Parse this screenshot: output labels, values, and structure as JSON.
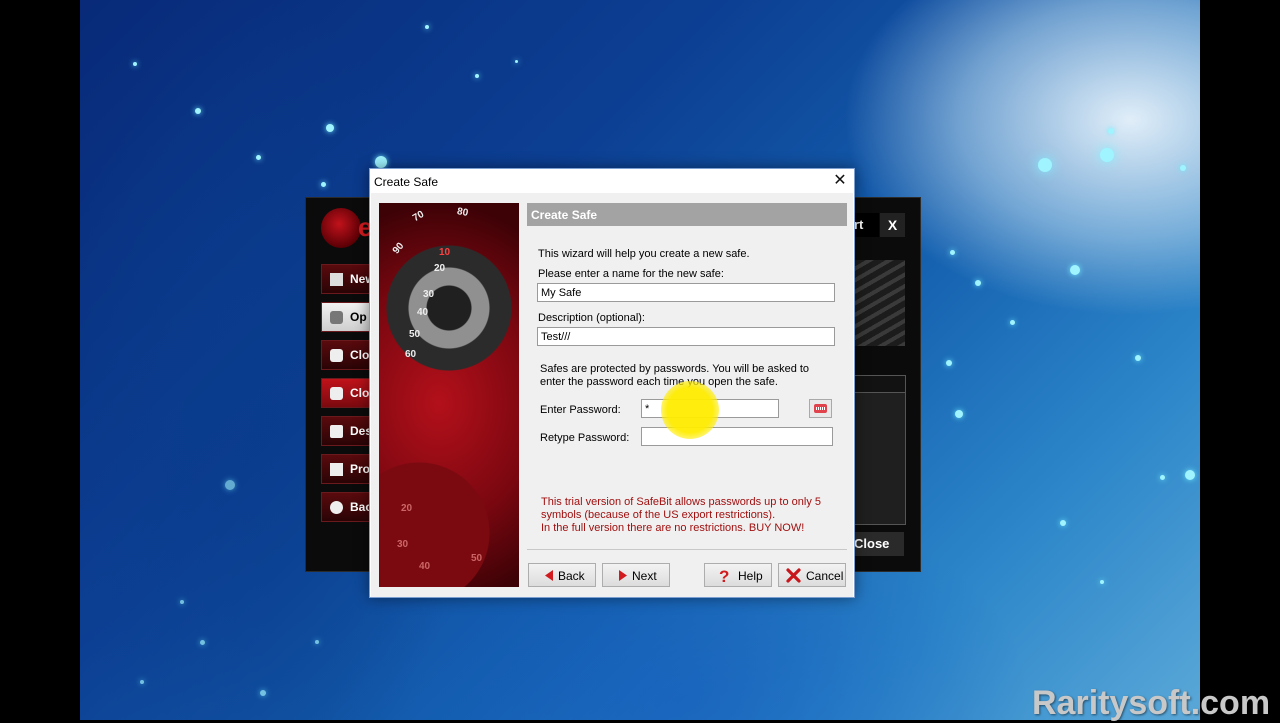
{
  "background_app": {
    "logo_letter": "e",
    "menu_items": [
      "New",
      "Op",
      "Clo",
      "Clo",
      "Des",
      "Pro",
      "Bac"
    ],
    "top_button_fragment": "rt",
    "close_x": "X",
    "close_label": "Close"
  },
  "dialog": {
    "title": "Create Safe",
    "close_glyph": "✕",
    "header_title": "Create Safe",
    "intro": "This wizard will help you create a new safe.",
    "name_label": "Please enter a name for the new safe:",
    "name_value": "My Safe",
    "description_label": "Description (optional):",
    "description_value": "Test///",
    "password_info_line1": "Safes are protected by passwords. You will be asked to",
    "password_info_line2": "enter the password each time you open the safe.",
    "enter_password_label": "Enter Password:",
    "enter_password_value": "*",
    "retype_password_label": "Retype Password:",
    "retype_password_value": "",
    "trial_line1": "This trial version of SafeBit allows passwords up to only 5",
    "trial_line2": "symbols (because of the US export restrictions).",
    "trial_line3": "In the full version there are no restrictions. BUY NOW!",
    "buttons": {
      "back": "Back",
      "next": "Next",
      "help": "Help",
      "cancel": "Cancel"
    },
    "dial_numbers": [
      "70",
      "80",
      "90",
      "10",
      "20",
      "30",
      "40",
      "50",
      "60",
      "20",
      "30",
      "40",
      "50"
    ]
  },
  "watermark": "Raritysoft.com",
  "colors": {
    "accent_red": "#d11b1f",
    "header_gray": "#a3a3a3",
    "warning_text": "#a01010",
    "highlight_yellow": "#ffec00"
  },
  "icons": {
    "back": "left-triangle-icon",
    "next": "right-triangle-icon",
    "help": "question-mark-icon",
    "cancel": "red-x-icon",
    "keyboard": "keyboard-icon"
  }
}
